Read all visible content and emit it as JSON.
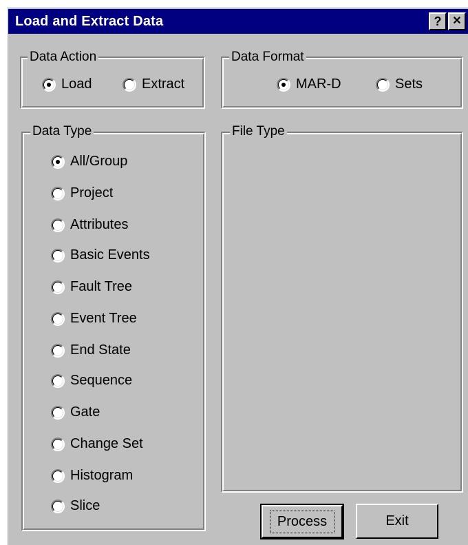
{
  "title": "Load and Extract Data",
  "titlebar": {
    "help_label": "?",
    "close_label": "✕"
  },
  "data_action": {
    "legend": "Data Action",
    "options": [
      {
        "label": "Load",
        "checked": true
      },
      {
        "label": "Extract",
        "checked": false
      }
    ]
  },
  "data_format": {
    "legend": "Data Format",
    "options": [
      {
        "label": "MAR-D",
        "checked": true
      },
      {
        "label": "Sets",
        "checked": false
      }
    ]
  },
  "data_type": {
    "legend": "Data Type",
    "options": [
      {
        "label": "All/Group",
        "checked": true
      },
      {
        "label": "Project",
        "checked": false
      },
      {
        "label": "Attributes",
        "checked": false
      },
      {
        "label": "Basic Events",
        "checked": false
      },
      {
        "label": "Fault Tree",
        "checked": false
      },
      {
        "label": "Event Tree",
        "checked": false
      },
      {
        "label": "End State",
        "checked": false
      },
      {
        "label": "Sequence",
        "checked": false
      },
      {
        "label": "Gate",
        "checked": false
      },
      {
        "label": "Change Set",
        "checked": false
      },
      {
        "label": "Histogram",
        "checked": false
      },
      {
        "label": "Slice",
        "checked": false
      }
    ]
  },
  "file_type": {
    "legend": "File Type"
  },
  "buttons": {
    "process": "Process",
    "exit": "Exit"
  },
  "colors": {
    "titlebar": "#000080",
    "face": "#c0c0c0"
  }
}
